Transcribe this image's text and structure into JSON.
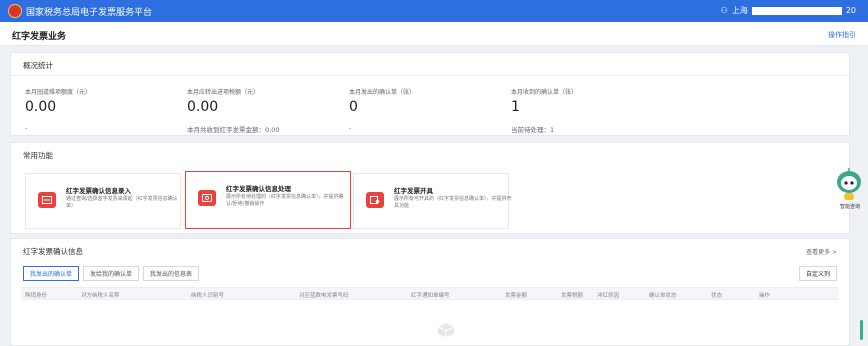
{
  "header": {
    "app_title": "国家税务总局电子发票服务平台",
    "user_prefix": "上海",
    "user_suffix": "20"
  },
  "page": {
    "title": "红字发票业务",
    "guide_link": "操作指引"
  },
  "overview": {
    "title": "概况统计",
    "stats": [
      {
        "label": "本月园道维项额度（元）",
        "value": "0.00",
        "foot": "-"
      },
      {
        "label": "本月应转出进项税额（元）",
        "value": "0.00",
        "foot": "本月共收到红字发票金额：0.00"
      },
      {
        "label": "本月发出的确认单（张）",
        "value": "0",
        "foot": "-"
      },
      {
        "label": "本月收到的确认单（张）",
        "value": "1",
        "foot": "当前待处理：1"
      }
    ]
  },
  "functions": {
    "title": "常用功能",
    "items": [
      {
        "title": "红字发票确认信息录入",
        "desc": "通过查询/选择蓝字发票来录起（红字发票信息确认单）"
      },
      {
        "title": "红字发票确认信息处理",
        "desc": "展示所有待处理的（红字发票信息确认单），并提供确认/拒绝/撤销操作"
      },
      {
        "title": "红字发票开具",
        "desc": "展示所有可开具的（红字发票信息确认单），并提供开具功能"
      }
    ]
  },
  "confirm_info": {
    "title": "红字发票确认信息",
    "more_link": "查看更多 >",
    "tabs": [
      "我发出的确认单",
      "发给我的确认单",
      "我发出的信息表"
    ],
    "custom_button": "自定义列",
    "columns": [
      "购销身份",
      "对方纳税人名称",
      "纳税人识别号",
      "对应蓝数电发票号码",
      "红字通知单编号",
      "发票金额",
      "发票税额",
      "冲红原因",
      "确认单状态",
      "状态",
      "操作"
    ]
  },
  "assistant": {
    "label": "智能咨询"
  },
  "colors": {
    "brand_blue": "#2d6fe0",
    "icon_red": "#e8423e",
    "highlight_red": "#e0443a"
  }
}
